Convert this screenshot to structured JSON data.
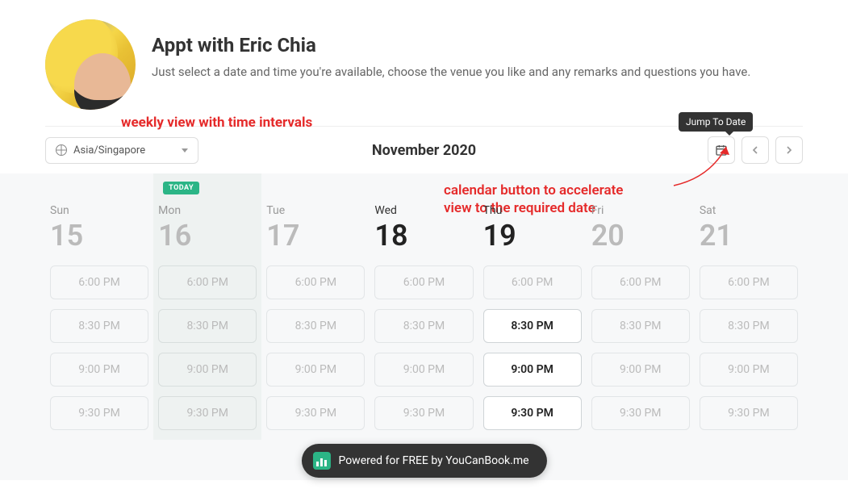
{
  "header": {
    "title": "Appt with Eric Chia",
    "subtitle": "Just select a date and time you're available, choose the venue you like and any remarks and questions you have."
  },
  "annotations": {
    "weekly_view": "weekly view with time intervals",
    "calendar_button_line1": "calendar button to accelerate",
    "calendar_button_line2": "view to the required date"
  },
  "toolbar": {
    "timezone": "Asia/Singapore",
    "month_label": "November 2020",
    "jump_tooltip": "Jump To Date"
  },
  "week": {
    "today_badge": "TODAY",
    "days": [
      {
        "dow": "Sun",
        "num": "15",
        "active": false,
        "today": false,
        "slots": [
          {
            "t": "6:00 PM",
            "a": false
          },
          {
            "t": "8:30 PM",
            "a": false
          },
          {
            "t": "9:00 PM",
            "a": false
          },
          {
            "t": "9:30 PM",
            "a": false
          }
        ]
      },
      {
        "dow": "Mon",
        "num": "16",
        "active": false,
        "today": true,
        "slots": [
          {
            "t": "6:00 PM",
            "a": false
          },
          {
            "t": "8:30 PM",
            "a": false
          },
          {
            "t": "9:00 PM",
            "a": false
          },
          {
            "t": "9:30 PM",
            "a": false
          }
        ]
      },
      {
        "dow": "Tue",
        "num": "17",
        "active": false,
        "today": false,
        "slots": [
          {
            "t": "6:00 PM",
            "a": false
          },
          {
            "t": "8:30 PM",
            "a": false
          },
          {
            "t": "9:00 PM",
            "a": false
          },
          {
            "t": "9:30 PM",
            "a": false
          }
        ]
      },
      {
        "dow": "Wed",
        "num": "18",
        "active": true,
        "today": false,
        "slots": [
          {
            "t": "6:00 PM",
            "a": false
          },
          {
            "t": "8:30 PM",
            "a": false
          },
          {
            "t": "9:00 PM",
            "a": false
          },
          {
            "t": "9:30 PM",
            "a": false
          }
        ]
      },
      {
        "dow": "Thu",
        "num": "19",
        "active": true,
        "today": false,
        "slots": [
          {
            "t": "6:00 PM",
            "a": false
          },
          {
            "t": "8:30 PM",
            "a": true
          },
          {
            "t": "9:00 PM",
            "a": true
          },
          {
            "t": "9:30 PM",
            "a": true
          }
        ]
      },
      {
        "dow": "Fri",
        "num": "20",
        "active": false,
        "today": false,
        "slots": [
          {
            "t": "6:00 PM",
            "a": false
          },
          {
            "t": "8:30 PM",
            "a": false
          },
          {
            "t": "9:00 PM",
            "a": false
          },
          {
            "t": "9:30 PM",
            "a": false
          }
        ]
      },
      {
        "dow": "Sat",
        "num": "21",
        "active": false,
        "today": false,
        "slots": [
          {
            "t": "6:00 PM",
            "a": false
          },
          {
            "t": "8:30 PM",
            "a": false
          },
          {
            "t": "9:00 PM",
            "a": false
          },
          {
            "t": "9:30 PM",
            "a": false
          }
        ]
      }
    ]
  },
  "footer": {
    "text": "Powered for FREE by YouCanBook.me"
  }
}
